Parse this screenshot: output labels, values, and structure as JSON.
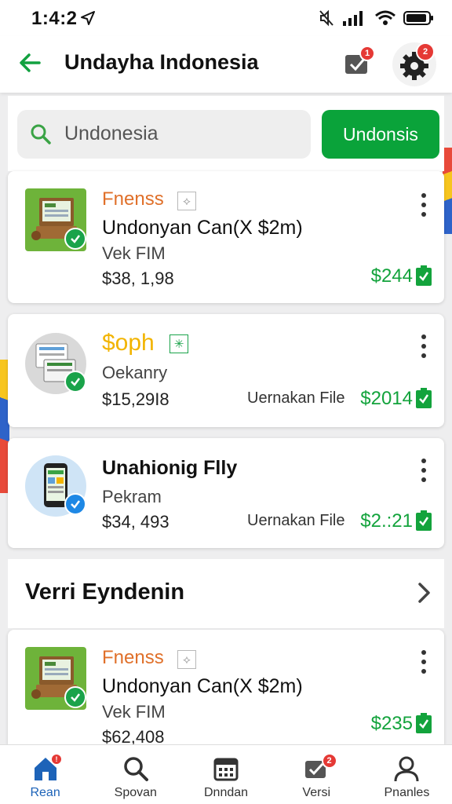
{
  "status_bar": {
    "time": "1:4:2"
  },
  "header": {
    "title": "Undayha Indonesia",
    "tasks_badge": "1",
    "gear_badge": "2"
  },
  "search": {
    "value": "Undonesia",
    "button_label": "Undonsis"
  },
  "cards": [
    {
      "category": "Fnenss",
      "title": "Undonyan Can(X $2m)",
      "subtitle": "Vek FIM",
      "price": "$38, 1,98",
      "file_label": "",
      "amount": "$244"
    },
    {
      "category": "$oph",
      "title": "",
      "subtitle": "Oekanry",
      "price": "$15,29I8",
      "file_label": "Uernakan File",
      "amount": "$2014"
    },
    {
      "category": "",
      "title": "Unahionig Flly",
      "subtitle": "Pekram",
      "price": "$34, 493",
      "file_label": "Uernakan File",
      "amount": "$2.:21"
    }
  ],
  "section": {
    "title": "Verri Eyndenin"
  },
  "section_card": {
    "category": "Fnenss",
    "title": "Undonyan Can(X $2m)",
    "subtitle": "Vek FIM",
    "price": "$62,408",
    "amount": "$235"
  },
  "nav": [
    {
      "label": "Rean",
      "icon": "home-icon",
      "badge": "!"
    },
    {
      "label": "Spovan",
      "icon": "search-icon"
    },
    {
      "label": "Dnndan",
      "icon": "calendar-icon"
    },
    {
      "label": "Versi",
      "icon": "tasks-icon",
      "badge": "2"
    },
    {
      "label": "Pnanles",
      "icon": "profile-icon"
    }
  ],
  "colors": {
    "accent": "#0aa33a",
    "category": "#e0702a",
    "gold": "#f2b400",
    "amount": "#13a33c",
    "nav_active": "#1d63b8",
    "badge": "#e53935"
  }
}
